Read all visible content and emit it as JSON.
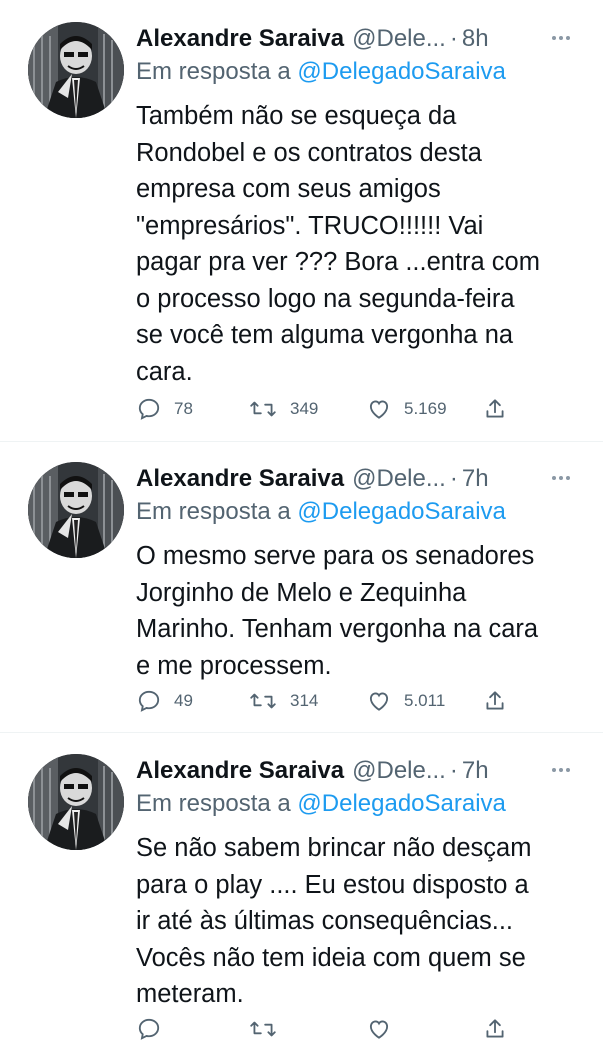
{
  "tweets": [
    {
      "author_name": "Alexandre Saraiva",
      "handle": "@Dele...",
      "separator": "·",
      "time": "8h",
      "reply_prefix": "Em resposta a",
      "reply_to": "@DelegadoSaraiva",
      "text": "Também não se esqueça da\nRondobel e os contratos desta\nempresa com seus amigos\n\"empresários\". TRUCO!!!!!! Vai\npagar pra ver ??? Bora ...entra com\no processo logo na segunda-feira\nse você tem alguma vergonha na\ncara.",
      "replies": "78",
      "retweets": "349",
      "likes": "5.169"
    },
    {
      "author_name": "Alexandre Saraiva",
      "handle": "@Dele...",
      "separator": "·",
      "time": "7h",
      "reply_prefix": "Em resposta a",
      "reply_to": "@DelegadoSaraiva",
      "text": "O mesmo serve para os senadores\nJorginho de Melo e Zequinha\nMarinho. Tenham vergonha na cara\ne me processem.",
      "replies": "49",
      "retweets": "314",
      "likes": "5.011"
    },
    {
      "author_name": "Alexandre Saraiva",
      "handle": "@Dele...",
      "separator": "·",
      "time": "7h",
      "reply_prefix": "Em resposta a",
      "reply_to": "@DelegadoSaraiva",
      "text": "Se não sabem brincar não desçam\npara o play .... Eu estou disposto a\nir até às últimas consequências...\nVocês não tem ideia com quem se\nmeteram.",
      "replies": "",
      "retweets": "",
      "likes": ""
    }
  ],
  "icons": {
    "reply": "reply-icon",
    "retweet": "retweet-icon",
    "like": "like-icon",
    "share": "share-icon",
    "more": "more-icon"
  },
  "colors": {
    "text": "#0f1419",
    "secondary": "#536471",
    "link": "#1d9bf0",
    "divider": "#eff3f4"
  }
}
